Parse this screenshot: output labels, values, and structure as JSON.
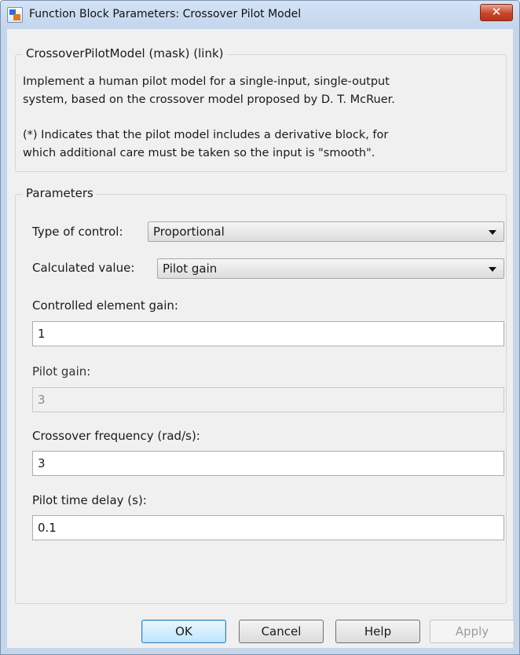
{
  "window": {
    "title": "Function Block Parameters: Crossover Pilot Model",
    "close_glyph": "✕"
  },
  "mask": {
    "group_label": "CrossoverPilotModel (mask) (link)",
    "description_lines": [
      "Implement a human pilot model for a single-input, single-output",
      "system, based on the crossover model proposed by D. T. McRuer.",
      "(*) Indicates that the pilot model includes a derivative block, for",
      "which additional care must be taken so the input is \"smooth\"."
    ]
  },
  "parameters": {
    "group_label": "Parameters",
    "type_of_control": {
      "label": "Type of control:",
      "value": "Proportional"
    },
    "calculated_value": {
      "label": "Calculated value:",
      "value": "Pilot gain"
    },
    "controlled_element_gain": {
      "label": "Controlled element gain:",
      "value": "1"
    },
    "pilot_gain": {
      "label": "Pilot gain:",
      "value": "3"
    },
    "crossover_frequency": {
      "label": "Crossover frequency (rad/s):",
      "value": "3"
    },
    "pilot_time_delay": {
      "label": "Pilot time delay (s):",
      "value": "0.1"
    }
  },
  "buttons": {
    "ok": "OK",
    "cancel": "Cancel",
    "help": "Help",
    "apply": "Apply"
  }
}
